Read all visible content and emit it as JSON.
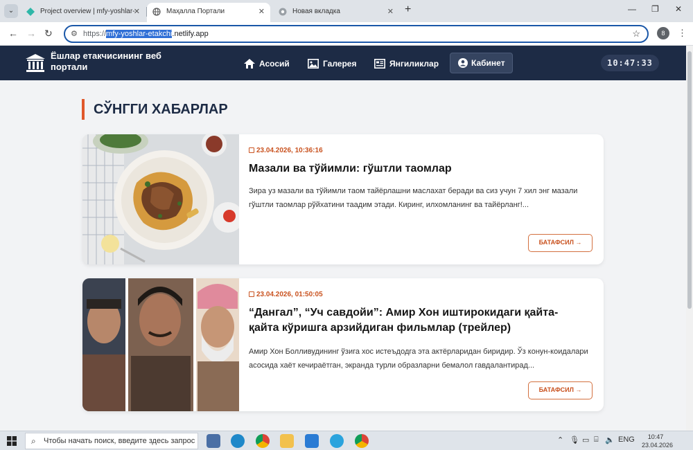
{
  "browser": {
    "tabs": [
      {
        "title": "Project overview | mfy-yoshlar-"
      },
      {
        "title": "Маҳалла Портали"
      },
      {
        "title": "Новая вкладка"
      }
    ],
    "url_scheme": "https://",
    "url_selected": "mfy-yoshlar-etakchi",
    "url_rest": ".netlify.app",
    "profile_initial": "8"
  },
  "site": {
    "title": "Ёшлар етакчисининг веб портали",
    "nav": [
      {
        "label": "Асосий",
        "icon": "home-icon"
      },
      {
        "label": "Галерея",
        "icon": "image-icon"
      },
      {
        "label": "Янгиликлар",
        "icon": "newspaper-icon"
      },
      {
        "label": "Кабинет",
        "icon": "user-circle-icon"
      }
    ],
    "clock": "10:47:33"
  },
  "section": {
    "title": "СЎНГГИ ХАБАРЛАР"
  },
  "posts": [
    {
      "date": "23.04.2026, 10:36:16",
      "title": "Мазали ва тўйимли: гўштли таомлар",
      "excerpt": "Зира уз мазали ва тўйимли таом тайёрлашни маслахат беради ва сиз учун 7 хил энг мазали гўштли таомлар рўйхатини таадим этади. Киринг, илхомланинг ва тайёрланг!...",
      "button": "БАТАФСИЛ →"
    },
    {
      "date": "23.04.2026, 01:50:05",
      "title": "“Дангал”, “Уч савдойи”: Амир Хон иштирокидаги қайта-қайта кўришга арзийдиган фильмлар (трейлер)",
      "excerpt": "Амир Хон Болливудининг ўзига хос истеъдодга эта актёрларидан биридир. Ўз конун-коидалари асосида хаёт кечираётган, экранда турли образларни бемалол гавдалантирад...",
      "button": "БАТАФСИЛ →"
    }
  ],
  "taskbar": {
    "search_placeholder": "Чтобы начать поиск, введите здесь запрос",
    "lang": "ENG",
    "time": "10:47",
    "date": "23.04.2026"
  },
  "colors": {
    "header_bg": "#1d2b45",
    "accent": "#e0582b",
    "accent_text": "#c9521f",
    "omnibox_border": "#1a57a8"
  }
}
